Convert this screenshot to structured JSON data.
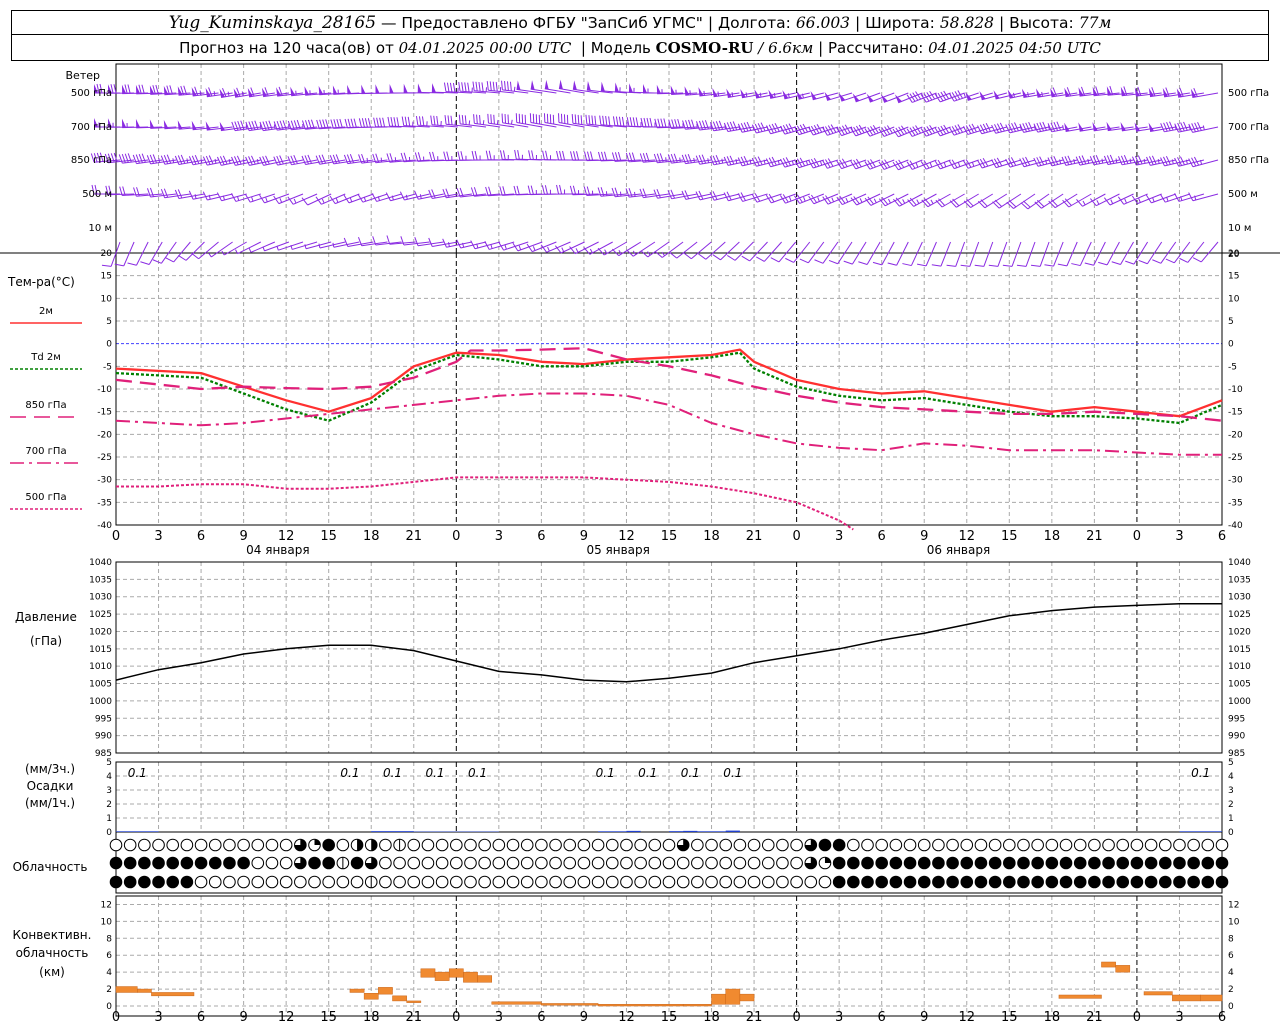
{
  "header": {
    "station": "Yug_Kuminskaya_28165",
    "provided": "— Предоставлено ФГБУ \"ЗапСиб УГМС\"",
    "lon_label": "Долгота:",
    "lon": "66.003",
    "lat_label": "Широта:",
    "lat": "58.828",
    "alt_label": "Высота:",
    "alt": "77м",
    "fc_prefix": "Прогноз на 120 часа(ов) от",
    "fc_start": "04.01.2025 00:00 UTC",
    "model_label": "Модель",
    "model": "COSMO-RU",
    "resolution": "/ 6.6км",
    "calc_label": "Рассчитано:",
    "calc_time": "04.01.2025 04:50 UTC"
  },
  "panels": {
    "wind": {
      "title": "Ветер",
      "levels": [
        "500 гПа",
        "700 гПа",
        "850 гПа",
        "500 м",
        "10 м"
      ],
      "color": "#8a2be2"
    },
    "temp": {
      "title": "Тем-ра(°C)",
      "yticks": [
        20,
        15,
        10,
        5,
        0,
        -5,
        -10,
        -15,
        -20,
        -25,
        -30,
        -35,
        -40
      ],
      "legend": [
        {
          "label": "2м",
          "color": "#ff3030"
        },
        {
          "label": "Td 2м",
          "color": "#008000"
        },
        {
          "label": "850 гПа",
          "color": "#e0207a"
        },
        {
          "label": "700 гПа",
          "color": "#e0207a"
        },
        {
          "label": "500 гПа",
          "color": "#e0207a"
        }
      ]
    },
    "pressure": {
      "title": "Давление",
      "unit": "(гПа)",
      "yticks": [
        1040,
        1035,
        1030,
        1025,
        1020,
        1015,
        1010,
        1005,
        1000,
        995,
        990,
        985
      ]
    },
    "precip": {
      "title": "Осадки",
      "unit1": "(мм/3ч.)",
      "unit2": "(мм/1ч.)",
      "yticks": [
        5,
        4,
        3,
        2,
        1,
        0
      ]
    },
    "cloud": {
      "title": "Облачность"
    },
    "conv": {
      "title1": "Конвективн.",
      "title2": "облачность",
      "unit": "(км)",
      "yticks": [
        12,
        10,
        8,
        6,
        4,
        2,
        0
      ]
    }
  },
  "time_axis": {
    "tick_labels": [
      "0",
      "3",
      "6",
      "9",
      "12",
      "15",
      "18",
      "21",
      "0",
      "3",
      "6",
      "9",
      "12",
      "15",
      "18",
      "21",
      "0",
      "3",
      "6",
      "9",
      "12",
      "15",
      "18",
      "21",
      "0",
      "3",
      "6"
    ],
    "day_labels": [
      "04 января",
      "05 января",
      "06 января"
    ]
  },
  "chart_data": {
    "type": "line",
    "x_unit": "hours since 04.01.2025 00:00 UTC",
    "xlim": [
      0,
      78
    ],
    "temperature": {
      "ylim": [
        -40,
        20
      ],
      "series": [
        {
          "name": "2м",
          "x": [
            0,
            3,
            6,
            9,
            12,
            15,
            18,
            21,
            24,
            27,
            30,
            33,
            36,
            39,
            42,
            44,
            45,
            48,
            51,
            54,
            57,
            60,
            63,
            66,
            69,
            72,
            75,
            78
          ],
          "values": [
            -5.5,
            -6,
            -6.5,
            -9.5,
            -12.5,
            -15,
            -12,
            -5,
            -2,
            -2.5,
            -4,
            -4.5,
            -3.5,
            -3,
            -2.5,
            -1.3,
            -4,
            -8,
            -10,
            -11,
            -10.5,
            -12,
            -13.5,
            -15,
            -14,
            -15,
            -16,
            -12.5
          ]
        },
        {
          "name": "Td 2м",
          "x": [
            0,
            3,
            6,
            9,
            12,
            15,
            18,
            21,
            24,
            27,
            30,
            33,
            36,
            39,
            42,
            44,
            45,
            48,
            51,
            54,
            57,
            60,
            63,
            66,
            69,
            72,
            75,
            78
          ],
          "values": [
            -6.5,
            -7,
            -7.5,
            -11,
            -14.5,
            -17,
            -13,
            -6,
            -2.5,
            -3.5,
            -5,
            -5,
            -4,
            -4,
            -3,
            -2,
            -5.5,
            -9.5,
            -11.5,
            -12.5,
            -12,
            -13.5,
            -15,
            -16,
            -16,
            -16.5,
            -17.5,
            -13.5
          ]
        },
        {
          "name": "850 гПа",
          "x": [
            0,
            3,
            6,
            9,
            12,
            15,
            18,
            21,
            24,
            25,
            27,
            30,
            33,
            36,
            39,
            42,
            45,
            48,
            51,
            54,
            57,
            60,
            63,
            66,
            69,
            72,
            75,
            78
          ],
          "values": [
            -8,
            -9,
            -10,
            -9.5,
            -9.8,
            -10,
            -9.5,
            -7.5,
            -4,
            -1.5,
            -1.5,
            -1.3,
            -1,
            -3.5,
            -5,
            -7,
            -9.5,
            -11.5,
            -13,
            -14,
            -14.5,
            -15,
            -15.5,
            -15.5,
            -15,
            -15.5,
            -16,
            -17
          ]
        },
        {
          "name": "700 гПа",
          "x": [
            0,
            3,
            6,
            9,
            12,
            15,
            18,
            21,
            24,
            27,
            30,
            33,
            36,
            39,
            42,
            45,
            48,
            51,
            54,
            57,
            60,
            63,
            66,
            69,
            72,
            75,
            78
          ],
          "values": [
            -17,
            -17.5,
            -18,
            -17.5,
            -16.5,
            -15.5,
            -14.5,
            -13.5,
            -12.5,
            -11.5,
            -11,
            -11,
            -11.5,
            -13.5,
            -17.5,
            -20,
            -22,
            -23,
            -23.5,
            -22,
            -22.5,
            -23.5,
            -23.5,
            -23.5,
            -24,
            -24.5,
            -24.5
          ]
        },
        {
          "name": "500 гПа",
          "x": [
            0,
            3,
            6,
            9,
            12,
            15,
            18,
            21,
            24,
            27,
            30,
            33,
            36,
            39,
            42,
            45,
            48,
            51,
            52
          ],
          "values": [
            -31.5,
            -31.5,
            -31,
            -31,
            -32,
            -32,
            -31.5,
            -30.5,
            -29.5,
            -29.5,
            -29.5,
            -29.5,
            -30,
            -30.5,
            -31.5,
            -33,
            -35,
            -39,
            -41
          ]
        }
      ]
    },
    "pressure": {
      "ylim": [
        985,
        1040
      ],
      "x": [
        0,
        3,
        6,
        9,
        12,
        15,
        18,
        21,
        24,
        27,
        30,
        33,
        36,
        39,
        42,
        45,
        48,
        51,
        54,
        57,
        60,
        63,
        66,
        69,
        72,
        75,
        78
      ],
      "values": [
        1006,
        1009,
        1011,
        1013.5,
        1015,
        1016,
        1016,
        1014.5,
        1011.5,
        1008.5,
        1007.5,
        1006,
        1005.5,
        1006.5,
        1008,
        1011,
        1013,
        1015,
        1017.5,
        1019.5,
        1022,
        1024.5,
        1026,
        1027,
        1027.5,
        1028,
        1028
      ]
    },
    "precip": {
      "ylim": [
        0,
        5
      ],
      "labels": [
        {
          "x": 1.5,
          "text": "0.1"
        },
        {
          "x": 16.5,
          "text": "0.1"
        },
        {
          "x": 19.5,
          "text": "0.1"
        },
        {
          "x": 22.5,
          "text": "0.1"
        },
        {
          "x": 25.5,
          "text": "0.1"
        },
        {
          "x": 34.5,
          "text": "0.1"
        },
        {
          "x": 37.5,
          "text": "0.1"
        },
        {
          "x": 40.5,
          "text": "0.1"
        },
        {
          "x": 43.5,
          "text": "0.1"
        },
        {
          "x": 76.5,
          "text": "0.1"
        }
      ],
      "bars": [
        {
          "x0": 0,
          "x1": 3,
          "v": 0.05
        },
        {
          "x0": 18,
          "x1": 21,
          "v": 0.06
        },
        {
          "x0": 21,
          "x1": 24,
          "v": 0.03
        },
        {
          "x0": 24,
          "x1": 27,
          "v": 0.03
        },
        {
          "x0": 34,
          "x1": 36,
          "v": 0.05
        },
        {
          "x0": 36,
          "x1": 37,
          "v": 0.08
        },
        {
          "x0": 39,
          "x1": 40,
          "v": 0.06
        },
        {
          "x0": 40,
          "x1": 41,
          "v": 0.08
        },
        {
          "x0": 41,
          "x1": 43,
          "v": 0.05
        },
        {
          "x0": 43,
          "x1": 44,
          "v": 0.1
        },
        {
          "x0": 75,
          "x1": 78,
          "v": 0.05
        }
      ]
    },
    "cloud": {
      "x_step_hours": 1,
      "rows": [
        "00000000000003640220100000000000000000003000000003440000000000000000000000000000004200000000000000000000000000000000000000000000",
        "44444444440003441430000000000000000000000000000003644444444444444444444444444444444444444440000000000000000000000000000000000000",
        "44444400000000000010000000000000000000000000000000044444444444444444444444444444444444444440000000000000000000000000000000000000"
      ]
    },
    "convective": {
      "ylim": [
        0,
        13
      ],
      "bars": [
        {
          "x0": 0,
          "x1": 1.5,
          "bot": 1.6,
          "top": 2.3
        },
        {
          "x0": 1.5,
          "x1": 2.5,
          "bot": 1.6,
          "top": 2.0
        },
        {
          "x0": 2.5,
          "x1": 5.5,
          "bot": 1.2,
          "top": 1.6
        },
        {
          "x0": 16.5,
          "x1": 17.5,
          "bot": 1.6,
          "top": 2.0
        },
        {
          "x0": 17.5,
          "x1": 18.5,
          "bot": 0.8,
          "top": 1.5
        },
        {
          "x0": 18.5,
          "x1": 19.5,
          "bot": 1.4,
          "top": 2.2
        },
        {
          "x0": 19.5,
          "x1": 20.5,
          "bot": 0.6,
          "top": 1.2
        },
        {
          "x0": 20.5,
          "x1": 21.5,
          "bot": 0.4,
          "top": 0.6
        },
        {
          "x0": 21.5,
          "x1": 22.5,
          "bot": 3.4,
          "top": 4.4
        },
        {
          "x0": 22.5,
          "x1": 23.5,
          "bot": 3.0,
          "top": 4.0
        },
        {
          "x0": 23.5,
          "x1": 24.5,
          "bot": 3.4,
          "top": 4.4
        },
        {
          "x0": 24.5,
          "x1": 25.5,
          "bot": 2.8,
          "top": 4.0
        },
        {
          "x0": 25.5,
          "x1": 26.5,
          "bot": 2.8,
          "top": 3.6
        },
        {
          "x0": 26.5,
          "x1": 30,
          "bot": 0.2,
          "top": 0.5
        },
        {
          "x0": 30,
          "x1": 34,
          "bot": 0.1,
          "top": 0.3
        },
        {
          "x0": 34,
          "x1": 40,
          "bot": 0.0,
          "top": 0.2
        },
        {
          "x0": 40,
          "x1": 42,
          "bot": 0.0,
          "top": 0.2
        },
        {
          "x0": 42,
          "x1": 43,
          "bot": 0.2,
          "top": 1.4
        },
        {
          "x0": 43,
          "x1": 44,
          "bot": 0.2,
          "top": 2.0
        },
        {
          "x0": 44,
          "x1": 45,
          "bot": 0.6,
          "top": 1.4
        },
        {
          "x0": 66.5,
          "x1": 69.5,
          "bot": 0.9,
          "top": 1.3
        },
        {
          "x0": 69.5,
          "x1": 70.5,
          "bot": 4.6,
          "top": 5.2
        },
        {
          "x0": 70.5,
          "x1": 71.5,
          "bot": 4.0,
          "top": 4.8
        },
        {
          "x0": 72.5,
          "x1": 74.5,
          "bot": 1.3,
          "top": 1.7
        },
        {
          "x0": 74.5,
          "x1": 76.5,
          "bot": 0.6,
          "top": 1.3
        },
        {
          "x0": 76.5,
          "x1": 78,
          "bot": 0.6,
          "top": 1.3
        }
      ]
    },
    "wind": {
      "unit": "barbs, speed in knots",
      "levels": [
        {
          "name": "500 гПа",
          "spd": [
            72,
            70,
            68,
            65,
            60,
            55,
            52,
            50,
            48,
            45,
            48,
            50,
            52,
            55,
            55,
            55,
            55,
            52,
            50,
            48,
            45,
            50,
            55,
            60,
            62,
            62,
            60
          ],
          "dir": [
            270,
            268,
            265,
            260,
            262,
            265,
            268,
            270,
            272,
            275,
            278,
            280,
            275,
            270,
            265,
            260,
            258,
            255,
            250,
            248,
            250,
            255,
            260,
            262,
            265,
            262,
            260
          ]
        },
        {
          "name": "700 гПа",
          "spd": [
            55,
            52,
            50,
            48,
            45,
            42,
            40,
            38,
            36,
            35,
            38,
            40,
            42,
            45,
            45,
            46,
            46,
            44,
            42,
            40,
            38,
            40,
            44,
            48,
            50,
            48,
            46
          ],
          "dir": [
            270,
            268,
            265,
            262,
            262,
            265,
            268,
            272,
            275,
            278,
            280,
            280,
            275,
            270,
            265,
            260,
            255,
            252,
            250,
            248,
            250,
            255,
            258,
            260,
            262,
            260,
            258
          ]
        },
        {
          "name": "850 гПа",
          "spd": [
            40,
            38,
            36,
            35,
            32,
            30,
            28,
            26,
            25,
            24,
            26,
            28,
            30,
            32,
            34,
            35,
            35,
            33,
            30,
            28,
            26,
            28,
            32,
            35,
            36,
            35,
            34
          ],
          "dir": [
            265,
            262,
            260,
            258,
            258,
            260,
            262,
            265,
            268,
            270,
            272,
            270,
            268,
            265,
            262,
            258,
            255,
            252,
            250,
            248,
            250,
            252,
            255,
            258,
            260,
            258,
            255
          ]
        },
        {
          "name": "500 м",
          "spd": [
            22,
            20,
            18,
            16,
            14,
            12,
            14,
            16,
            18,
            20,
            22,
            24,
            24,
            22,
            20,
            20,
            22,
            24,
            25,
            24,
            22,
            20,
            18,
            18,
            16,
            16,
            14
          ],
          "dir": [
            270,
            265,
            260,
            255,
            250,
            245,
            250,
            255,
            260,
            265,
            268,
            270,
            265,
            262,
            258,
            255,
            250,
            248,
            245,
            242,
            240,
            238,
            235,
            240,
            245,
            250,
            255
          ]
        },
        {
          "name": "10 м",
          "spd": [
            12,
            10,
            8,
            7,
            6,
            6,
            8,
            10,
            12,
            14,
            15,
            15,
            14,
            13,
            12,
            12,
            12,
            12,
            12,
            11,
            10,
            10,
            10,
            10,
            10,
            10,
            9
          ],
          "dir": [
            200,
            210,
            225,
            240,
            250,
            255,
            260,
            265,
            260,
            255,
            250,
            245,
            240,
            235,
            230,
            225,
            220,
            215,
            210,
            205,
            200,
            200,
            200,
            205,
            210,
            215,
            220
          ]
        }
      ]
    }
  }
}
